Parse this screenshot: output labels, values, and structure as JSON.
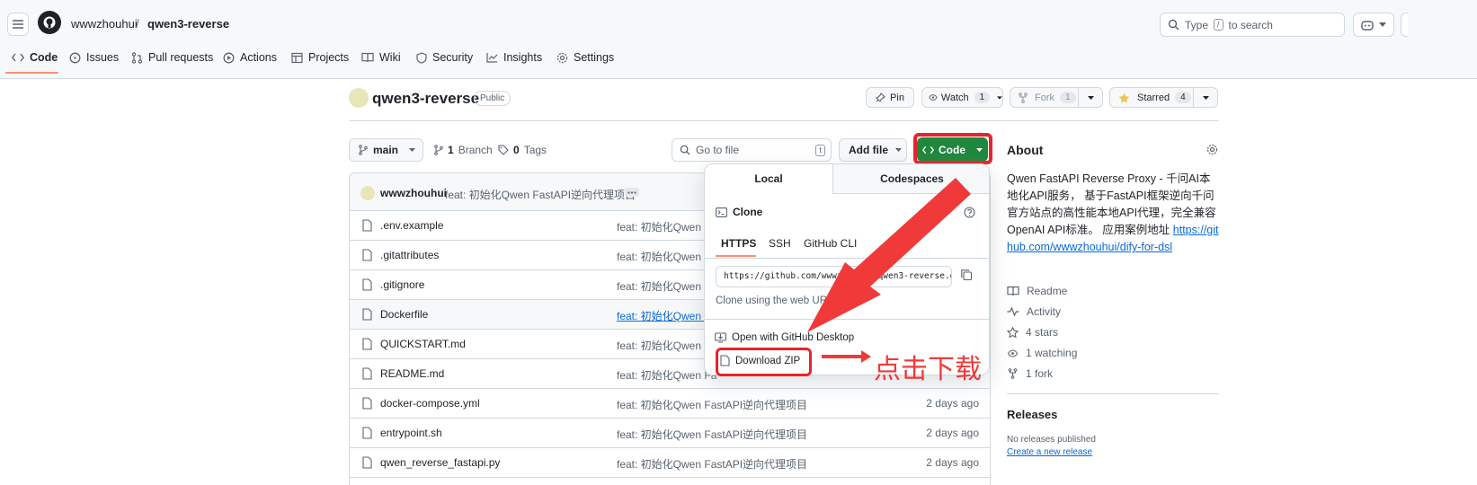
{
  "header": {
    "owner": "wwwzhouhui",
    "separator": "/",
    "repo": "qwen3-reverse",
    "search_prefix": "Type",
    "search_key": "/",
    "search_suffix": "to search"
  },
  "nav": {
    "tabs": [
      {
        "label": "Code"
      },
      {
        "label": "Issues"
      },
      {
        "label": "Pull requests"
      },
      {
        "label": "Actions"
      },
      {
        "label": "Projects"
      },
      {
        "label": "Wiki"
      },
      {
        "label": "Security"
      },
      {
        "label": "Insights"
      },
      {
        "label": "Settings"
      }
    ]
  },
  "repo": {
    "name": "qwen3-reverse",
    "visibility": "Public",
    "pin": "Pin",
    "watch": "Watch",
    "watch_count": "1",
    "fork": "Fork",
    "fork_count": "1",
    "starred": "Starred",
    "star_count": "4"
  },
  "toolbar": {
    "branch": "main",
    "branches_count": "1",
    "branches_label": "Branch",
    "tags_count": "0",
    "tags_label": "Tags",
    "go_to_file": "Go to file",
    "go_to_file_key": "t",
    "add_file": "Add file",
    "code": "Code"
  },
  "commit": {
    "author": "wwwzhouhui",
    "message": "feat: 初始化Qwen FastAPI逆向代理项目"
  },
  "files": [
    {
      "name": ".env.example",
      "msg": "feat: 初始化Qwen Fa",
      "date": ""
    },
    {
      "name": ".gitattributes",
      "msg": "feat: 初始化Qwen Fa",
      "date": ""
    },
    {
      "name": ".gitignore",
      "msg": "feat: 初始化Qwen Fa",
      "date": ""
    },
    {
      "name": "Dockerfile",
      "msg": "feat: 初始化Qwen Fa",
      "date": ""
    },
    {
      "name": "QUICKSTART.md",
      "msg": "feat: 初始化Qwen Fa",
      "date": ""
    },
    {
      "name": "README.md",
      "msg": "feat: 初始化Qwen Fa",
      "date": ""
    },
    {
      "name": "docker-compose.yml",
      "msg": "feat: 初始化Qwen FastAPI逆向代理项目",
      "date": "2 days ago"
    },
    {
      "name": "entrypoint.sh",
      "msg": "feat: 初始化Qwen FastAPI逆向代理项目",
      "date": "2 days ago"
    },
    {
      "name": "qwen_reverse_fastapi.py",
      "msg": "feat: 初始化Qwen FastAPI逆向代理项目",
      "date": "2 days ago"
    }
  ],
  "dropdown": {
    "tab_local": "Local",
    "tab_codespaces": "Codespaces",
    "clone_title": "Clone",
    "proto_https": "HTTPS",
    "proto_ssh": "SSH",
    "proto_cli": "GitHub CLI",
    "url": "https://github.com/wwwzhouhui/qwen3-reverse.git",
    "clone_hint": "Clone using the web URL.",
    "open_desktop": "Open with GitHub Desktop",
    "download_zip": "Download ZIP"
  },
  "annotation": {
    "text": "点击下载",
    "color": "#f03a3a"
  },
  "about": {
    "title": "About",
    "description": "Qwen FastAPI Reverse Proxy - 千问AI本地化API服务， 基于FastAPI框架逆向千问官方站点的高性能本地API代理，完全兼容OpenAI API标准。 应用案例地址",
    "link": "https://github.com/wwwzhouhui/dify-for-dsl",
    "readme": "Readme",
    "activity": "Activity",
    "stars": "4 stars",
    "watching": "1 watching",
    "forks": "1 fork"
  },
  "releases": {
    "title": "Releases",
    "none": "No releases published",
    "create": "Create a new release"
  },
  "colors": {
    "accent_green": "#1f883d",
    "highlight_red": "#e8232b",
    "tab_underline": "#fd8c73",
    "link_blue": "#0969da"
  }
}
